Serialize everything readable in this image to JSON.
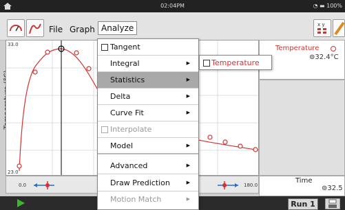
{
  "status": {
    "time": "02:04PM",
    "battery": "100%"
  },
  "menu": {
    "file": "File",
    "graph": "Graph",
    "analyze": "Analyze"
  },
  "graph": {
    "y_label": "Temperature (°C)",
    "y_max": "33.0",
    "y_min": "23.0",
    "x_min": "0.0",
    "x_max": "180.0",
    "series_color": "#d23232"
  },
  "dropdown": {
    "items": [
      {
        "label": "Tangent",
        "checkbox": true
      },
      {
        "label": "Integral",
        "submenu": true
      },
      {
        "label": "Statistics",
        "submenu": true,
        "highlighted": true
      },
      {
        "label": "Delta",
        "submenu": true
      },
      {
        "label": "Curve Fit",
        "submenu": true
      },
      {
        "label": "Interpolate",
        "checkbox": true,
        "disabled": true
      },
      {
        "label": "Model",
        "submenu": true
      },
      {
        "label": "Advanced",
        "submenu": true
      },
      {
        "label": "Draw Prediction",
        "submenu": true
      },
      {
        "label": "Motion Match",
        "submenu": true,
        "disabled": true
      }
    ]
  },
  "submenu": {
    "label": "Temperature"
  },
  "meter_temp": {
    "label": "Temperature",
    "value": "32.4"
  },
  "meter_time": {
    "label": "Time",
    "value": "32.5"
  },
  "footer": {
    "run_label": "Run 1"
  }
}
